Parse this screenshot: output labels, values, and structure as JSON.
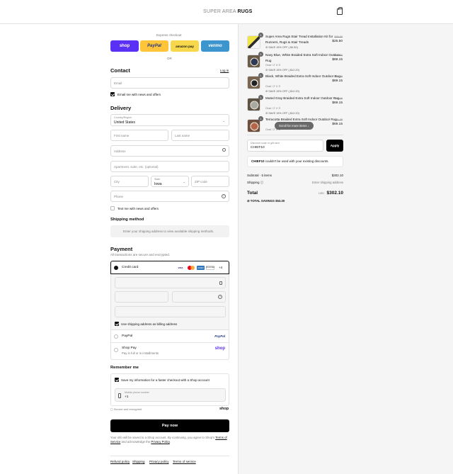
{
  "header": {
    "brand_light": "SUPER AREA ",
    "brand_bold": "RUGS",
    "cart_icon": "shopping-bag-icon"
  },
  "express": {
    "title": "Express checkout",
    "shop_label": "shop",
    "paypal_label": "PayPal",
    "amazon_label": "amazon pay",
    "venmo_label": "venmo",
    "or_label": "OR"
  },
  "contact": {
    "title": "Contact",
    "login_label": "Log in",
    "email_placeholder": "Email",
    "newsletter_label": "Email me with news and offers",
    "newsletter_checked": true
  },
  "delivery": {
    "title": "Delivery",
    "country_label": "Country/Region",
    "country_value": "United States",
    "first_name_placeholder": "First name",
    "last_name_placeholder": "Last name",
    "address_placeholder": "Address",
    "apartment_placeholder": "Apartment, suite, etc. (optional)",
    "city_placeholder": "City",
    "state_label": "State",
    "state_value": "Iowa",
    "zip_placeholder": "ZIP code",
    "phone_placeholder": "Phone",
    "sms_label": "Text me with news and offers"
  },
  "shipping": {
    "title": "Shipping method",
    "notice": "Enter your shipping address to view available shipping methods."
  },
  "payment": {
    "title": "Payment",
    "subtitle": "All transactions are secure and encrypted.",
    "credit_card_label": "Credit card",
    "card_visa": "VISA",
    "card_amex": "AMEX",
    "card_discover": "DISCOVER",
    "card_more": "+4",
    "billing_same_label": "Use shipping address as billing address",
    "paypal_option": "PayPal",
    "paypal_logo": "PayPal",
    "shoppay_option": "Shop Pay",
    "shoppay_sub": "Pay in full or in installments",
    "shoppay_logo": "shop"
  },
  "remember": {
    "title": "Remember me",
    "save_info_label": "Save my information for a faster checkout with a Shop account",
    "mobile_label": "Mobile phone number",
    "mobile_value": "+1",
    "secure_label": "Secure and encrypted",
    "shop_logo": "shop"
  },
  "pay_now_label": "Pay now",
  "legal": {
    "line1": "Your info will be saved to a Shop account. By continuing, you agree to Shop's",
    "terms_link": "Terms of Service",
    "and_text": " and acknowledge the ",
    "privacy_link": "Privacy Policy",
    "end": "."
  },
  "footer": {
    "refund": "Refund policy",
    "shipping": "Shipping",
    "privacy": "Privacy policy",
    "terms": "Terms of service"
  },
  "cart": {
    "items": [
      {
        "qty": "1",
        "title": "Super Area Rugs Stair Tread Installation Kit for Runners, Rugs & Stair Treads",
        "sub": "",
        "save": "SAVE 15% OFF (-$4.50)",
        "old": "$30.00",
        "price": "$25.50"
      },
      {
        "qty": "1",
        "title": "Navy Blue, White Braided Extra Soft Indoor Outdoor Rug",
        "sub": "Oval / 2' X 3'",
        "save": "SAVE 15% OFF (-$12.20)",
        "old": "$81.35",
        "price": "$69.15"
      },
      {
        "qty": "1",
        "title": "Black, White Braided Extra Soft Indoor Outdoor Rug",
        "sub": "Oval / 2' X 3'",
        "save": "SAVE 15% OFF (-$12.20)",
        "old": "$81.35",
        "price": "$69.15"
      },
      {
        "qty": "1",
        "title": "Muted Gray Braided Extra Soft Indoor Outdoor Rug",
        "sub": "Oval / 2' X 3'",
        "save": "SAVE 15% OFF (-$12.20)",
        "old": "$81.35",
        "price": "$69.15"
      },
      {
        "qty": "1",
        "title": "Terracotta Braided Extra Soft Indoor Outdoor Rug",
        "sub": "Oval / 2' X 3'",
        "save": "",
        "old": "$81.35",
        "price": "$69.15"
      }
    ],
    "scroll_hint": "Scroll for more items",
    "discount_label": "Discount code or gift card",
    "discount_value": "CHIEF10",
    "apply_label": "Apply",
    "discount_error_code": "CHIEF10",
    "discount_error_text": " couldn't be used with your existing discounts.",
    "subtotal_label": "Subtotal · 5 items",
    "subtotal_value": "$302.10",
    "shipping_label": "Shipping",
    "shipping_value": "Enter shipping address",
    "total_label": "Total",
    "currency": "USD",
    "total_value": "$302.10",
    "savings_label": "TOTAL SAVINGS",
    "savings_value": "$53.30"
  },
  "colors": {
    "shop_purple": "#5a31f4",
    "paypal_yellow": "#ffc439",
    "amazon_yellow": "#f7d74c",
    "venmo_blue": "#3d95ce",
    "pay_button": "#000000"
  }
}
